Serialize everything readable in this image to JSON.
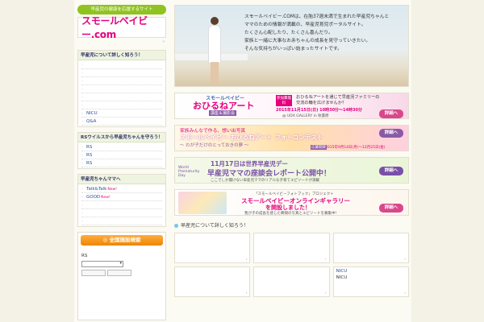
{
  "sidebar": {
    "tagline": "早産児の健康を応援するサイト",
    "logo": "スモールベイビー.com",
    "logo_arrow": "›",
    "sections": [
      {
        "title": "早産児について詳しく知ろう！",
        "items": [
          {
            "label": ""
          },
          {
            "label": ""
          },
          {
            "label": ""
          },
          {
            "label": ""
          },
          {
            "label": ""
          },
          {
            "label": ""
          },
          {
            "label": "NICU"
          },
          {
            "label": "Q&A"
          }
        ]
      },
      {
        "title": "RSウイルスから早産児ちゃんを守ろう！",
        "items": [
          {
            "label": "RS"
          },
          {
            "label": "RS"
          },
          {
            "label": "RS"
          }
        ]
      },
      {
        "title": "早産児ちゃんママへ",
        "items": [
          {
            "label": "Talk&Talk",
            "badge": "New!"
          },
          {
            "label": "GOOD",
            "badge": "New!"
          },
          {
            "label": ""
          },
          {
            "label": ""
          },
          {
            "label": ""
          }
        ]
      }
    ],
    "facility": {
      "title": "全国施設検索",
      "label": "RS",
      "select_arrow": "▾"
    },
    "bullet_glyph": "◦"
  },
  "main": {
    "hero_lines": [
      "スモールベイビー.COMは、在胎37週未満で生まれた早産児ちゃんと",
      "ママのための情報が満載の、早産児育児ポータルサイト。",
      "たくさん心配したり、たくさん喜んだり。",
      "家族と一緒に大事なお赤ちゃんの成長を見守っていきたい。",
      "そんな気持ちがいっぱい詰まったサイトです。"
    ],
    "banners": [
      {
        "line1": "スモールベイビー",
        "line2": "おひるねアート",
        "badge": "参加費無料",
        "sub": "講座＆撮影会",
        "date": "2015年11月15日(日)  10時30分〜14時30分",
        "venue": "@ UDX GALLERY in 秋葉原",
        "desc": "おひるねアートを通じて早産児ファミリーの交流の輪を広げませんか？",
        "button": "詳細へ"
      },
      {
        "line0": "家族みんなで作る、想い出写真",
        "line1": "スモールベイビー おひるねアート フォトコンテスト",
        "line2": "〜 わが子だけのとっておきの夢 〜",
        "period_label": "応募期間",
        "period": "2015年9月14日(月)〜12月25日(金)",
        "button": "詳細へ"
      },
      {
        "line1": "11月17日は世界早産児デー",
        "line2": "早産児ママの座談会レポート公開中！",
        "line3": "ここでしか聞けない早産児ママのリアルな子育てエピソードが満載",
        "badge": "World Prematurity Day",
        "button": "詳細へ"
      },
      {
        "line0": "「スモールベイビーフォトブック」プロジェクト",
        "line1": "スモールベイビーオンラインギャラリー",
        "line2": "を開設しました！",
        "line3": "我が子の成長を感じた瞬間の写真とエピソードを募集中！",
        "button": "詳細へ"
      }
    ],
    "section_title": "早産児について詳しく知ろう！",
    "cells": [
      {
        "title": "",
        "text": ""
      },
      {
        "title": "",
        "text": ""
      },
      {
        "title": "",
        "text": ""
      },
      {
        "title": "",
        "text": ""
      },
      {
        "title": "",
        "text": ""
      },
      {
        "title": "NICU",
        "text": "NICU"
      }
    ],
    "cell_arrow": "›"
  },
  "colors": {
    "brand": "#e4007f",
    "tag_green": "#8fc31f",
    "link": "#2a4f9c",
    "orange": "#ee8500",
    "detail_pink": "#d9488c",
    "detail_purple": "#8a5aa8",
    "detail_violet": "#7a4fa8"
  },
  "icons": {
    "facility": "search-icon",
    "bullets": "bullet-icon",
    "heart": "heart-icon"
  }
}
